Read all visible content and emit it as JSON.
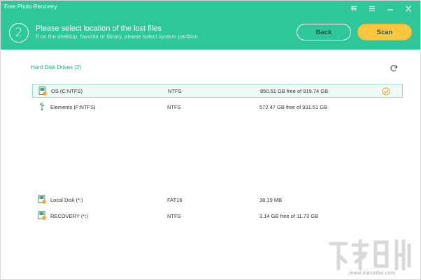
{
  "window": {
    "title": "Free Photo Recovery"
  },
  "window_controls": [
    {
      "icon": "menu-icon"
    },
    {
      "icon": "toggle-icon"
    },
    {
      "icon": "minimize-icon"
    },
    {
      "icon": "close-icon"
    }
  ],
  "step": {
    "number": "2",
    "title": "Please select location of the lost files",
    "subtitle": "If on the desktop, favorite or library, please select system partition"
  },
  "buttons": {
    "back": "Back",
    "scan": "Scan"
  },
  "section": {
    "label": "Hard Disk Drives (2)"
  },
  "drives": [
    {
      "name": "OS (C:NTFS)",
      "fs": "NTFS",
      "space": "850.51 GB free of 919.74 GB",
      "selected": true
    },
    {
      "name": "Elements (F:NTFS)",
      "fs": "NTFS",
      "space": "572.47 GB free of 931.51 GB",
      "selected": false
    },
    {
      "name": "Local Disk (*:)",
      "fs": "FAT16",
      "space": "38.19 MB",
      "selected": false
    },
    {
      "name": "RECOVERY (*:)",
      "fs": "NTFS",
      "space": "3.14 GB free of 11.73 GB",
      "selected": false
    }
  ],
  "watermark": {
    "url": "www.xiazaiba.com"
  },
  "colors": {
    "header": "#2ec79a",
    "scan": "#ffc53d",
    "accent": "#2a9d7e"
  }
}
